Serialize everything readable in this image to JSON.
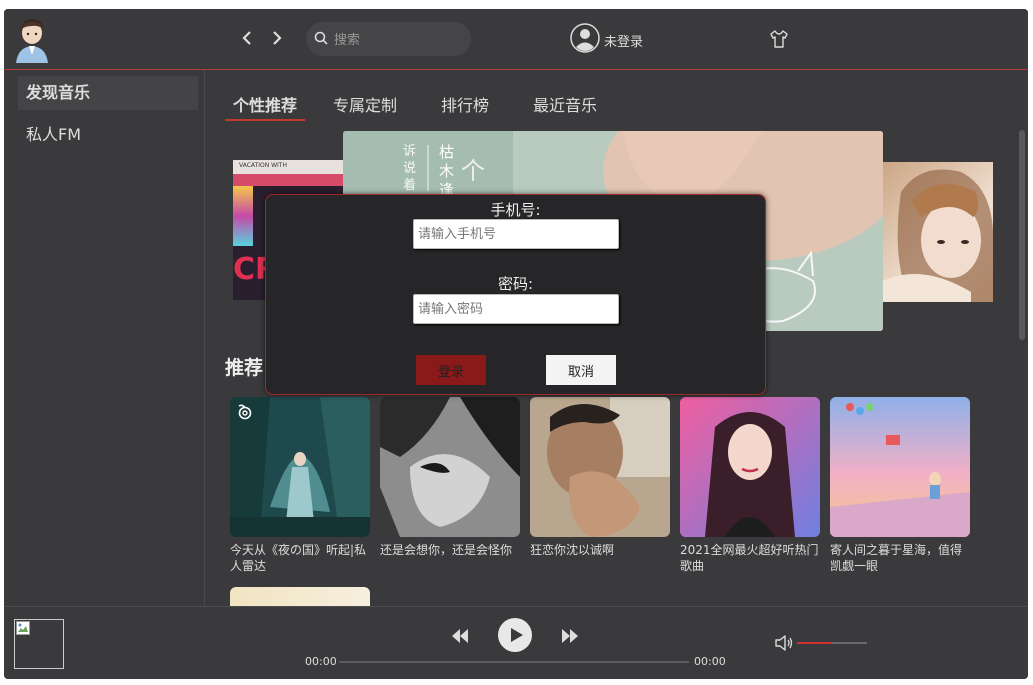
{
  "header": {
    "search_placeholder": "搜索",
    "user_name": "未登录"
  },
  "sidebar": {
    "items": [
      {
        "label": "发现音乐",
        "active": true
      },
      {
        "label": "私人FM",
        "active": false
      }
    ]
  },
  "tabs": [
    {
      "label": "个性推荐",
      "active": true
    },
    {
      "label": "专属定制",
      "active": false
    },
    {
      "label": "排行榜",
      "active": false
    },
    {
      "label": "最近音乐",
      "active": false
    }
  ],
  "banner": {
    "left_text": "VACATION WITH",
    "center_text_1": "诉说着",
    "center_text_2": "枯木逢",
    "center_text_3": "个"
  },
  "section": {
    "title_visible": "推荐"
  },
  "playlists": [
    {
      "title": "今天从《夜の国》听起|私人雷达",
      "icon": "radar-icon"
    },
    {
      "title": "还是会想你，还是会怪你"
    },
    {
      "title": "狂恋你沈以诚啊"
    },
    {
      "title": "2021全网最火超好听热门歌曲"
    },
    {
      "title": "寄人间之暮于星海，值得凯觑一眼"
    }
  ],
  "login_modal": {
    "phone_label": "手机号:",
    "phone_placeholder": "请输入手机号",
    "password_label": "密码:",
    "password_placeholder": "请输入密码",
    "login_button": "登录",
    "cancel_button": "取消"
  },
  "player": {
    "current_time": "00:00",
    "total_time": "00:00",
    "progress": 0,
    "volume": 0.5
  },
  "colors": {
    "accent": "#c0392b",
    "background": "#3a3a3c",
    "modal_bg": "#262628"
  }
}
